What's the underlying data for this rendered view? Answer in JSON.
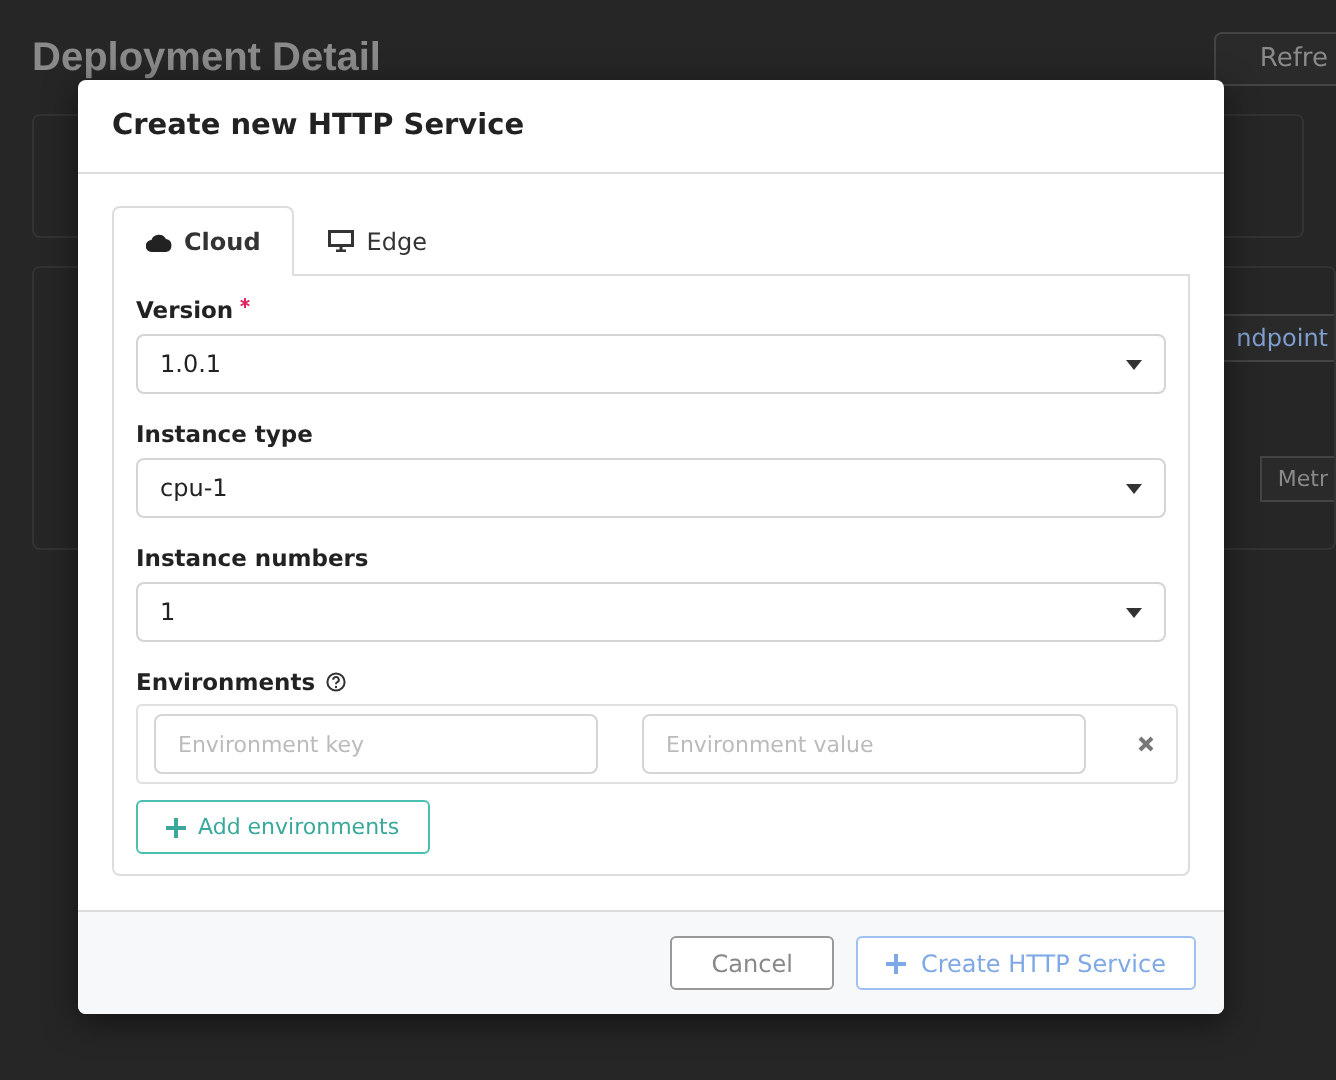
{
  "page": {
    "title": "Deployment Detail",
    "refresh_button": "Refre",
    "endpoint_button": "ndpoint",
    "metrics_button": "Metr"
  },
  "dialog": {
    "title": "Create new HTTP Service",
    "tabs": [
      {
        "label": "Cloud",
        "selected": true
      },
      {
        "label": "Edge",
        "selected": false
      }
    ],
    "fields": [
      {
        "label": "Version",
        "required": true,
        "value": "1.0.1"
      },
      {
        "label": "Instance type",
        "required": false,
        "value": "cpu-1"
      },
      {
        "label": "Instance numbers",
        "required": false,
        "value": "1"
      }
    ],
    "environments": {
      "label": "Environments",
      "rows": [
        {
          "key_placeholder": "Environment key",
          "value_placeholder": "Environment value"
        }
      ],
      "add_button": "Add environments"
    },
    "buttons": [
      {
        "label": "Cancel",
        "kind": "secondary"
      },
      {
        "label": "Create HTTP Service",
        "kind": "primary"
      }
    ]
  }
}
